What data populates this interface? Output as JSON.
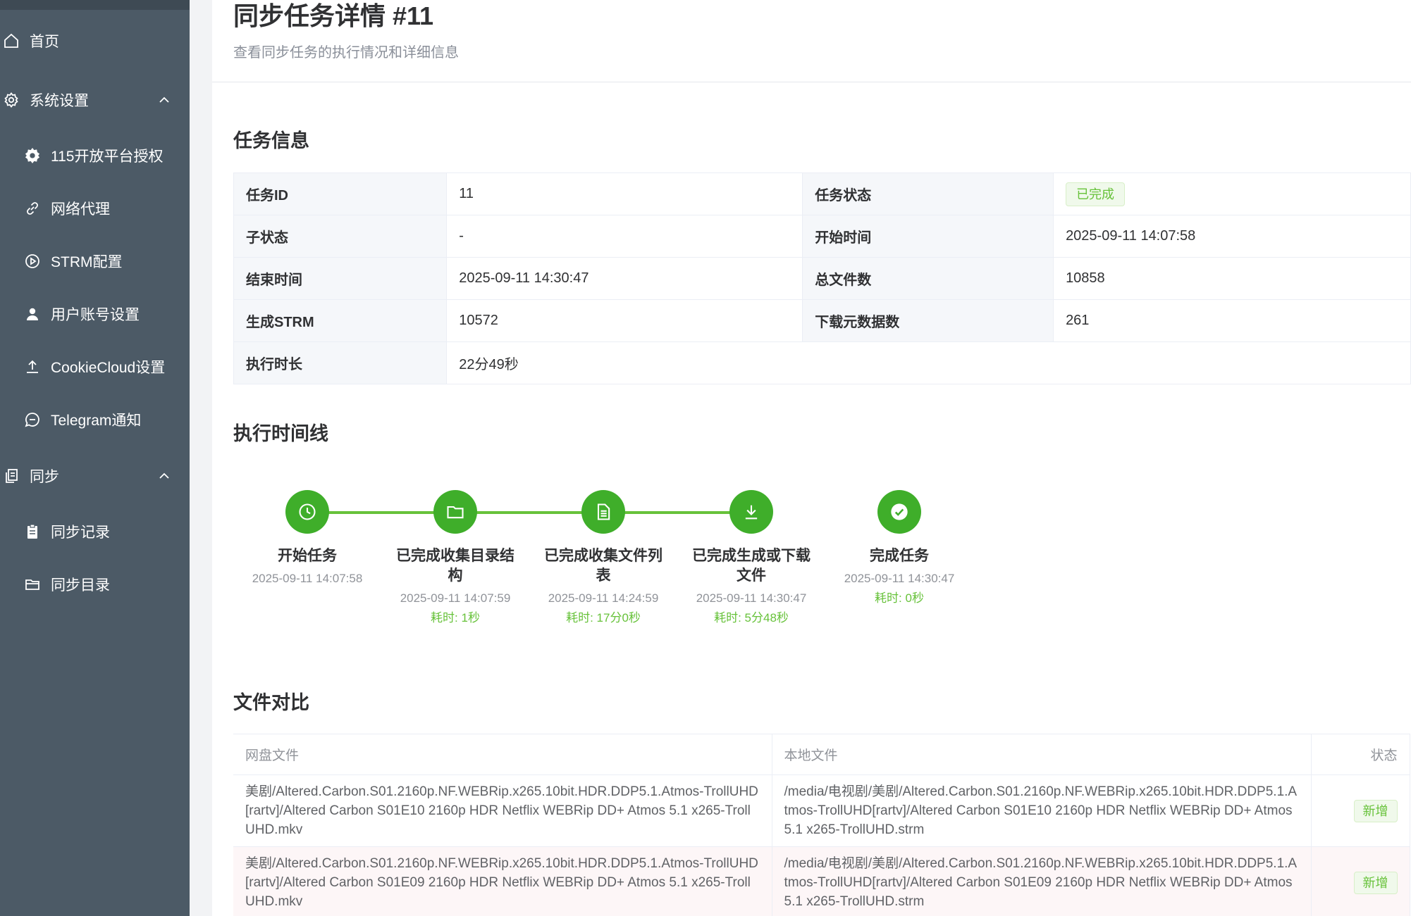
{
  "sidebar": {
    "items": [
      {
        "label": "首页",
        "icon": "home-icon"
      },
      {
        "label": "系统设置",
        "icon": "gear-outline-icon",
        "expanded": true
      },
      {
        "label": "115开放平台授权",
        "icon": "gear-icon"
      },
      {
        "label": "网络代理",
        "icon": "link-icon"
      },
      {
        "label": "STRM配置",
        "icon": "play-circle-icon"
      },
      {
        "label": "用户账号设置",
        "icon": "user-icon"
      },
      {
        "label": "CookieCloud设置",
        "icon": "upload-icon"
      },
      {
        "label": "Telegram通知",
        "icon": "chat-icon"
      },
      {
        "label": "同步",
        "icon": "copy-icon",
        "expanded": true
      },
      {
        "label": "同步记录",
        "icon": "clipboard-icon"
      },
      {
        "label": "同步目录",
        "icon": "folder-icon"
      }
    ]
  },
  "header": {
    "title": "同步任务详情 #11",
    "description": "查看同步任务的执行情况和详细信息"
  },
  "task_info": {
    "section_title": "任务信息",
    "rows": [
      {
        "l1": "任务ID",
        "v1": "11",
        "l2": "任务状态",
        "v2": "已完成"
      },
      {
        "l1": "子状态",
        "v1": "-",
        "l2": "开始时间",
        "v2": "2025-09-11 14:07:58"
      },
      {
        "l1": "结束时间",
        "v1": "2025-09-11 14:30:47",
        "l2": "总文件数",
        "v2": "10858"
      },
      {
        "l1": "生成STRM",
        "v1": "10572",
        "l2": "下载元数据数",
        "v2": "261"
      },
      {
        "l1": "执行时长",
        "v1": "22分49秒"
      }
    ],
    "status_color": "#67c23a"
  },
  "timeline": {
    "section_title": "执行时间线",
    "steps": [
      {
        "title": "开始任务",
        "time": "2025-09-11 14:07:58",
        "cost": "",
        "icon": "clock-icon"
      },
      {
        "title": "已完成收集目录结构",
        "time": "2025-09-11 14:07:59",
        "cost": "耗时: 1秒",
        "icon": "folder-icon"
      },
      {
        "title": "已完成收集文件列表",
        "time": "2025-09-11 14:24:59",
        "cost": "耗时: 17分0秒",
        "icon": "document-icon"
      },
      {
        "title": "已完成生成或下载文件",
        "time": "2025-09-11 14:30:47",
        "cost": "耗时: 5分48秒",
        "icon": "download-icon"
      },
      {
        "title": "完成任务",
        "time": "2025-09-11 14:30:47",
        "cost": "耗时: 0秒",
        "icon": "check-circle-icon"
      }
    ],
    "accent": "#3fae2a"
  },
  "file_compare": {
    "section_title": "文件对比",
    "columns": [
      "网盘文件",
      "本地文件",
      "状态"
    ],
    "rows": [
      {
        "remote": "美剧/Altered.Carbon.S01.2160p.NF.WEBRip.x265.10bit.HDR.DDP5.1.Atmos-TrollUHD[rartv]/Altered Carbon S01E10 2160p HDR Netflix WEBRip DD+ Atmos 5.1 x265-TrollUHD.mkv",
        "local": "/media/电视剧/美剧/Altered.Carbon.S01.2160p.NF.WEBRip.x265.10bit.HDR.DDP5.1.Atmos-TrollUHD[rartv]/Altered Carbon S01E10 2160p HDR Netflix WEBRip DD+ Atmos 5.1 x265-TrollUHD.strm",
        "status": "新增"
      },
      {
        "remote": "美剧/Altered.Carbon.S01.2160p.NF.WEBRip.x265.10bit.HDR.DDP5.1.Atmos-TrollUHD[rartv]/Altered Carbon S01E09 2160p HDR Netflix WEBRip DD+ Atmos 5.1 x265-TrollUHD.mkv",
        "local": "/media/电视剧/美剧/Altered.Carbon.S01.2160p.NF.WEBRip.x265.10bit.HDR.DDP5.1.Atmos-TrollUHD[rartv]/Altered Carbon S01E09 2160p HDR Netflix WEBRip DD+ Atmos 5.1 x265-TrollUHD.strm",
        "status": "新增"
      }
    ]
  }
}
